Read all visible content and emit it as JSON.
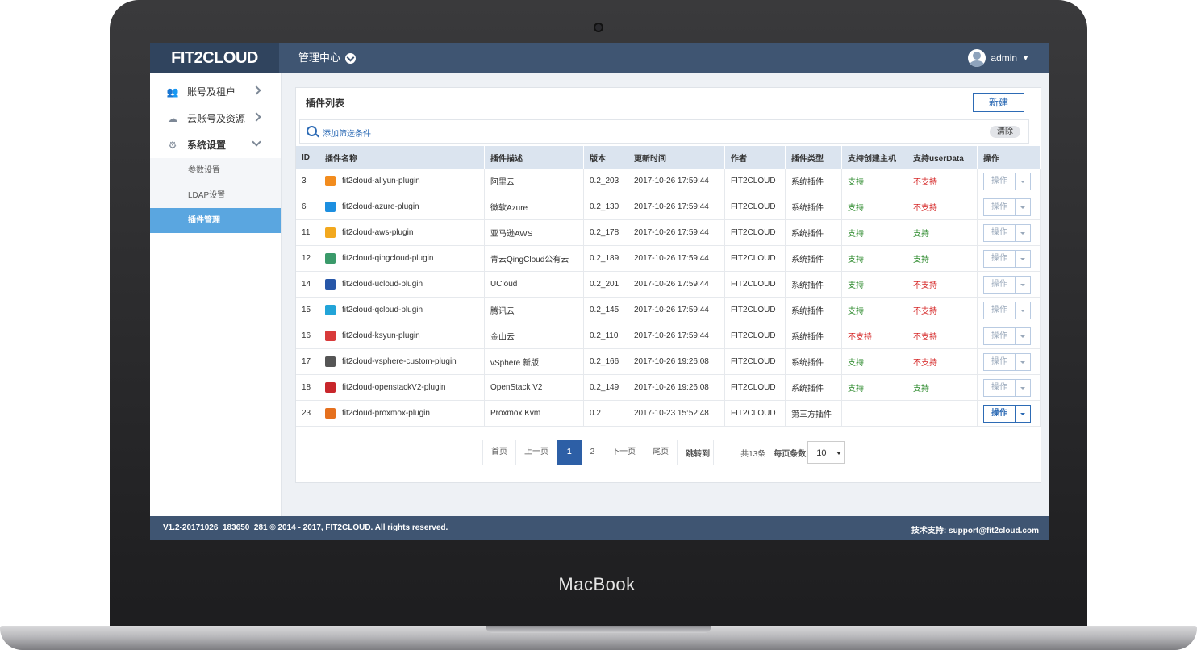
{
  "brand": "MacBook",
  "app": {
    "logo": "FIT2CLOUD",
    "center_menu": "管理中心",
    "user": "admin"
  },
  "sidebar": {
    "items": [
      {
        "label": "账号及租户",
        "icon": "users-icon"
      },
      {
        "label": "云账号及资源",
        "icon": "cloud-icon"
      },
      {
        "label": "系统设置",
        "icon": "gear-icon"
      }
    ],
    "sub_items": [
      "参数设置",
      "LDAP设置",
      "插件管理"
    ]
  },
  "panel": {
    "title": "插件列表",
    "new_button": "新建",
    "filter_text": "添加筛选条件",
    "clear_button": "清除"
  },
  "table": {
    "headers": [
      "ID",
      "插件名称",
      "插件描述",
      "版本",
      "更新时间",
      "作者",
      "插件类型",
      "支持创建主机",
      "支持userData",
      "操作"
    ],
    "rows": [
      {
        "id": "3",
        "name": "fit2cloud-aliyun-plugin",
        "desc": "阿里云",
        "version": "0.2_203",
        "time": "2017-10-26 17:59:44",
        "author": "FIT2CLOUD",
        "type": "系统插件",
        "host": "支持",
        "userdata": "不支持",
        "op": "操作",
        "icon_color": "#f28c1e"
      },
      {
        "id": "6",
        "name": "fit2cloud-azure-plugin",
        "desc": "微软Azure",
        "version": "0.2_130",
        "time": "2017-10-26 17:59:44",
        "author": "FIT2CLOUD",
        "type": "系统插件",
        "host": "支持",
        "userdata": "不支持",
        "op": "操作",
        "icon_color": "#1d8fe0"
      },
      {
        "id": "11",
        "name": "fit2cloud-aws-plugin",
        "desc": "亚马逊AWS",
        "version": "0.2_178",
        "time": "2017-10-26 17:59:44",
        "author": "FIT2CLOUD",
        "type": "系统插件",
        "host": "支持",
        "userdata": "支持",
        "op": "操作",
        "icon_color": "#f2a81e"
      },
      {
        "id": "12",
        "name": "fit2cloud-qingcloud-plugin",
        "desc": "青云QingCloud公有云",
        "version": "0.2_189",
        "time": "2017-10-26 17:59:44",
        "author": "FIT2CLOUD",
        "type": "系统插件",
        "host": "支持",
        "userdata": "支持",
        "op": "操作",
        "icon_color": "#3a9a6a"
      },
      {
        "id": "14",
        "name": "fit2cloud-ucloud-plugin",
        "desc": "UCloud",
        "version": "0.2_201",
        "time": "2017-10-26 17:59:44",
        "author": "FIT2CLOUD",
        "type": "系统插件",
        "host": "支持",
        "userdata": "不支持",
        "op": "操作",
        "icon_color": "#2757a8"
      },
      {
        "id": "15",
        "name": "fit2cloud-qcloud-plugin",
        "desc": "腾讯云",
        "version": "0.2_145",
        "time": "2017-10-26 17:59:44",
        "author": "FIT2CLOUD",
        "type": "系统插件",
        "host": "支持",
        "userdata": "不支持",
        "op": "操作",
        "icon_color": "#22a4d8"
      },
      {
        "id": "16",
        "name": "fit2cloud-ksyun-plugin",
        "desc": "金山云",
        "version": "0.2_110",
        "time": "2017-10-26 17:59:44",
        "author": "FIT2CLOUD",
        "type": "系统插件",
        "host": "不支持",
        "userdata": "不支持",
        "op": "操作",
        "icon_color": "#d83a3a"
      },
      {
        "id": "17",
        "name": "fit2cloud-vsphere-custom-plugin",
        "desc": "vSphere 新版",
        "version": "0.2_166",
        "time": "2017-10-26 19:26:08",
        "author": "FIT2CLOUD",
        "type": "系统插件",
        "host": "支持",
        "userdata": "不支持",
        "op": "操作",
        "icon_color": "#555555"
      },
      {
        "id": "18",
        "name": "fit2cloud-openstackV2-plugin",
        "desc": "OpenStack V2",
        "version": "0.2_149",
        "time": "2017-10-26 19:26:08",
        "author": "FIT2CLOUD",
        "type": "系统插件",
        "host": "支持",
        "userdata": "支持",
        "op": "操作",
        "icon_color": "#c8262b"
      },
      {
        "id": "23",
        "name": "fit2cloud-proxmox-plugin",
        "desc": "Proxmox Kvm",
        "version": "0.2",
        "time": "2017-10-23 15:52:48",
        "author": "FIT2CLOUD",
        "type": "第三方插件",
        "host": "",
        "userdata": "",
        "op": "操作",
        "icon_color": "#e5701e"
      }
    ]
  },
  "pagination": {
    "first": "首页",
    "prev": "上一页",
    "pages": [
      "1",
      "2"
    ],
    "next": "下一页",
    "last": "尾页",
    "jump_label": "跳转到",
    "total": "共13条",
    "per_page_label": "每页条数",
    "per_page_value": "10"
  },
  "footer": {
    "left": "V1.2-20171026_183650_281 © 2014 - 2017, FIT2CLOUD. All rights reserved.",
    "right": "技术支持: support@fit2cloud.com"
  }
}
